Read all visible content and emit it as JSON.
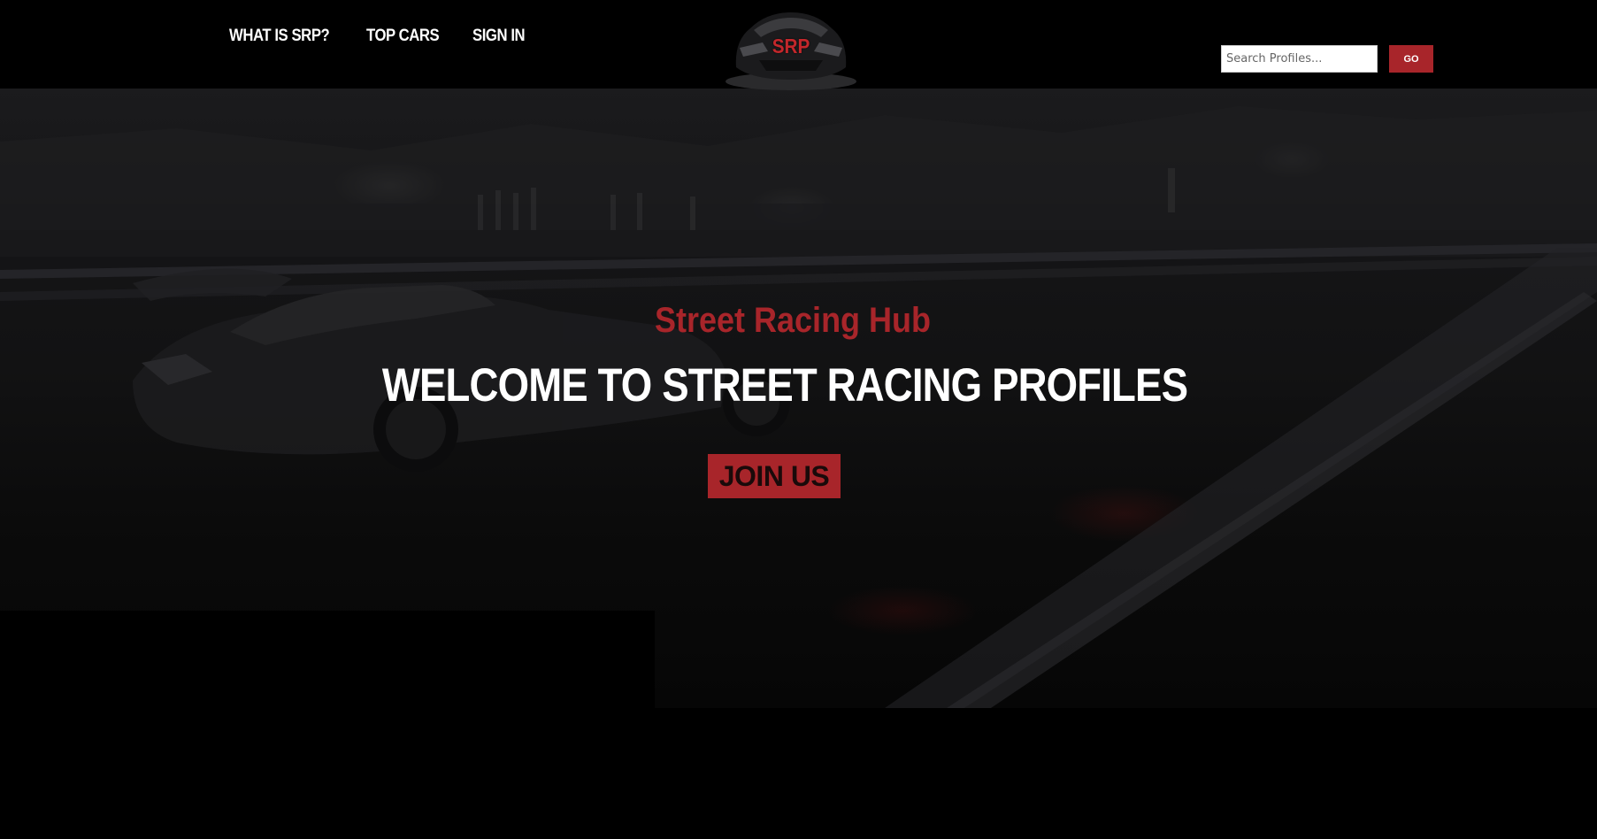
{
  "header": {
    "nav": [
      {
        "label": "WHAT IS SRP?"
      },
      {
        "label": "TOP CARS"
      },
      {
        "label": "SIGN IN"
      }
    ],
    "logo_text": "SRP",
    "search": {
      "placeholder": "Search Profiles...",
      "button_label": "GO"
    }
  },
  "hero": {
    "subtitle": "Street Racing Hub",
    "title": "WELCOME TO STREET RACING PROFILES",
    "cta_label": "JOIN US"
  },
  "colors": {
    "accent": "#a8252a",
    "background": "#000000",
    "text": "#ffffff"
  }
}
